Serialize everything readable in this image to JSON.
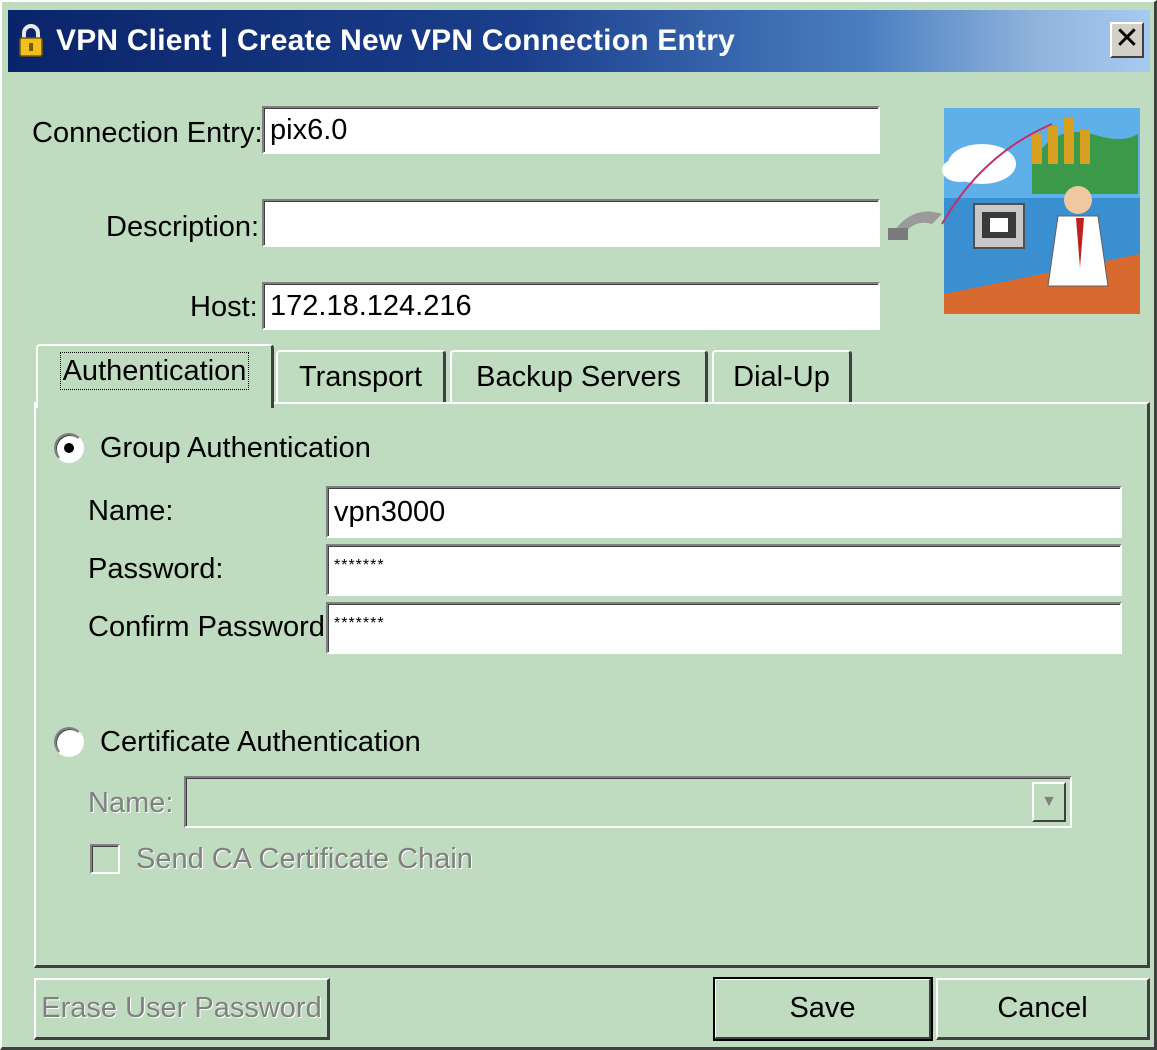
{
  "window": {
    "title": "VPN Client  |  Create New VPN Connection Entry",
    "close_glyph": "✕"
  },
  "form": {
    "connection_entry": {
      "label": "Connection Entry:",
      "value": "pix6.0"
    },
    "description": {
      "label": "Description:",
      "value": ""
    },
    "host": {
      "label": "Host:",
      "value": "172.18.124.216"
    }
  },
  "tabs": [
    {
      "label": "Authentication",
      "active": true
    },
    {
      "label": "Transport",
      "active": false
    },
    {
      "label": "Backup Servers",
      "active": false
    },
    {
      "label": "Dial-Up",
      "active": false
    }
  ],
  "authentication": {
    "group": {
      "label": "Group Authentication",
      "selected": true,
      "name": {
        "label": "Name:",
        "value": "vpn3000"
      },
      "password": {
        "label": "Password:",
        "value": "*******"
      },
      "confirm_password": {
        "label": "Confirm Password:",
        "value": "*******"
      }
    },
    "certificate": {
      "label": "Certificate Authentication",
      "selected": false,
      "name": {
        "label": "Name:",
        "value": ""
      },
      "send_ca_chain": {
        "label": "Send CA Certificate Chain",
        "checked": false
      }
    }
  },
  "buttons": {
    "erase_password": "Erase User Password",
    "save": "Save",
    "cancel": "Cancel"
  },
  "icons": {
    "title_icon": "padlock-icon",
    "illustration": "vpn-user-illustration"
  },
  "colors": {
    "window_bg": "#c0dcc0",
    "titlebar_start": "#0a246a",
    "titlebar_end": "#a6caf0",
    "disabled_text": "#808080"
  }
}
